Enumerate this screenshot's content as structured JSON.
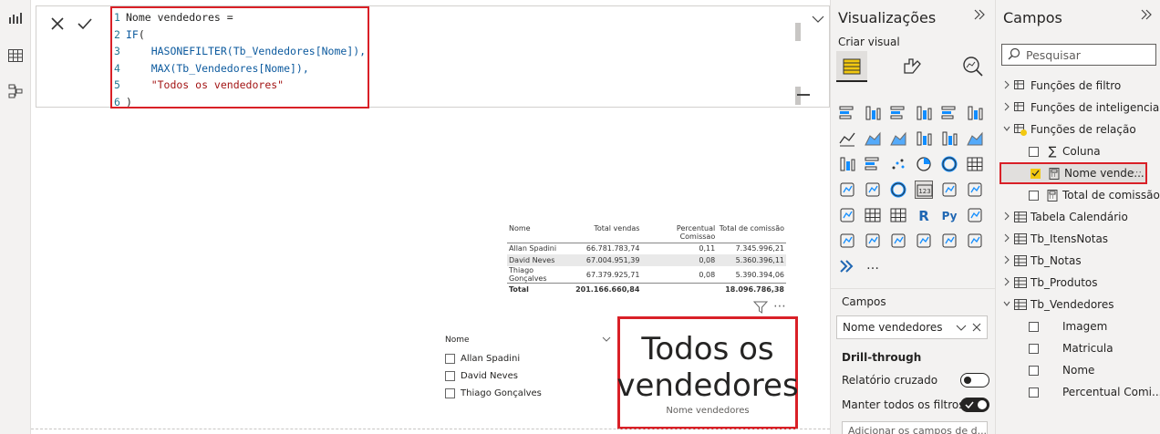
{
  "editor": {
    "lines": [
      {
        "n": "1",
        "parts": [
          {
            "c": "tx",
            "t": "Nome vendedores ="
          }
        ]
      },
      {
        "n": "2",
        "parts": [
          {
            "c": "kw",
            "t": "IF"
          },
          {
            "c": "tx",
            "t": "("
          }
        ]
      },
      {
        "n": "3",
        "parts": [
          {
            "c": "fn",
            "t": "    HASONEFILTER(Tb_Vendedores[Nome]),"
          }
        ]
      },
      {
        "n": "4",
        "parts": [
          {
            "c": "fn",
            "t": "    MAX(Tb_Vendedores[Nome]),"
          }
        ]
      },
      {
        "n": "5",
        "parts": [
          {
            "c": "str",
            "t": "    \"Todos os vendedores\""
          }
        ]
      },
      {
        "n": "6",
        "parts": [
          {
            "c": "tx",
            "t": ")"
          }
        ]
      }
    ]
  },
  "table": {
    "headers": [
      "Nome",
      "Total vendas",
      "Percentual Comissao",
      "Total de comissão"
    ],
    "rows": [
      [
        "Allan Spadini",
        "66.781.783,74",
        "0,11",
        "7.345.996,21"
      ],
      [
        "David Neves",
        "67.004.951,39",
        "0,08",
        "5.360.396,11"
      ],
      [
        "Thiago Gonçalves",
        "67.379.925,71",
        "0,08",
        "5.390.394,06"
      ]
    ],
    "total": [
      "Total",
      "201.166.660,84",
      "",
      "18.096.786,38"
    ]
  },
  "slicer": {
    "title": "Nome",
    "items": [
      "Allan Spadini",
      "David Neves",
      "Thiago Gonçalves"
    ]
  },
  "card": {
    "value_line1": "Todos os",
    "value_line2": "vendedores",
    "label": "Nome vendedores"
  },
  "visualizations": {
    "title": "Visualizações",
    "build_visual": "Criar visual",
    "fields_section": "Campos",
    "field_well_value": "Nome vendedores",
    "drill_through": "Drill-through",
    "cross_report": "Relatório cruzado",
    "keep_filters": "Manter todos os filtros",
    "add_drill_fields": "Adicionar os campos de d..."
  },
  "fields": {
    "title": "Campos",
    "search_placeholder": "Pesquisar",
    "tables": [
      {
        "label": "Funções de filtro"
      },
      {
        "label": "Funções de inteligencia..."
      },
      {
        "label": "Funções de relação"
      }
    ],
    "relation_children": [
      {
        "label": "Coluna",
        "kind": "sigma"
      },
      {
        "label": "Nome vende...",
        "kind": "calc"
      },
      {
        "label": "Total de comissão",
        "kind": "calc"
      }
    ],
    "more_tables": [
      "Tabela Calendário",
      "Tb_ItensNotas",
      "Tb_Notas",
      "Tb_Produtos",
      "Tb_Vendedores"
    ],
    "vendedores_children": [
      "Imagem",
      "Matricula",
      "Nome",
      "Percentual Comi..."
    ]
  },
  "colors": {
    "accent": "#f2c811",
    "highlight": "#d92027",
    "toggle_on": "#252423"
  }
}
